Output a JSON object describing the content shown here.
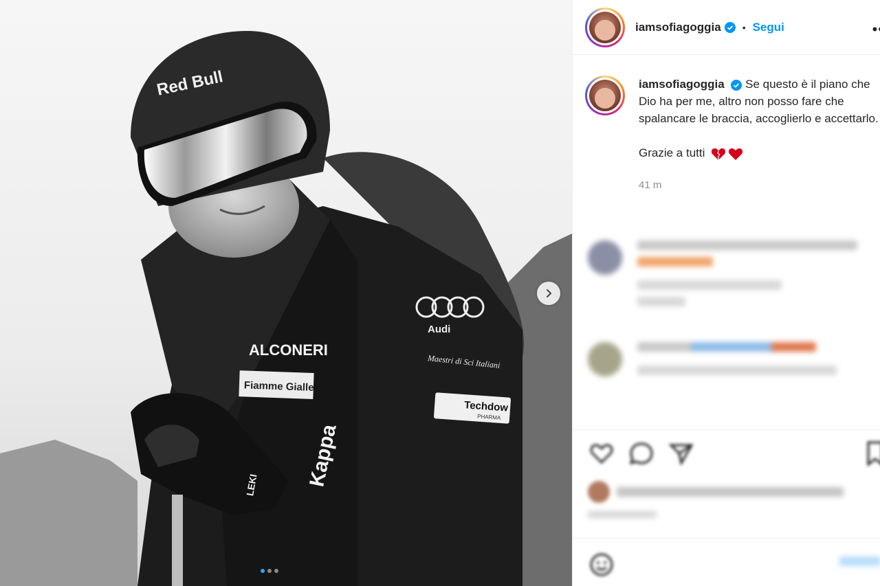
{
  "post": {
    "username": "iamsofiagoggia",
    "follow_label": "Segui",
    "separator": "•",
    "more_label": "••",
    "caption_text": "Se questo è il piano che Dio ha per me, altro non posso fare che spalancare le braccia, accoglierlo e accettarlo.\n\nGrazie a tutti",
    "caption_emojis": [
      "broken-heart-icon",
      "heart-icon"
    ],
    "time_ago": "41 m"
  },
  "media": {
    "helmet_brand": "Red Bull",
    "jacket_sponsor": "ALCONERI",
    "jacket_audi": "Audi",
    "jacket_badge_1": "Fiamme Gialle",
    "jacket_badge_2": "Maestri di Sci Italiani",
    "jacket_badge_3": "Techdow",
    "jacket_badge_3_sub": "PHARMA",
    "glove_brand": "Kappa",
    "pole_brand": "LEKI",
    "carousel_dots": 3,
    "active_dot": 0
  },
  "colors": {
    "accent_blue": "#0095f6",
    "verified_blue": "#0095f6",
    "heart_red": "#d6001c",
    "border": "#efefef",
    "muted_text": "#8e8e8e"
  }
}
